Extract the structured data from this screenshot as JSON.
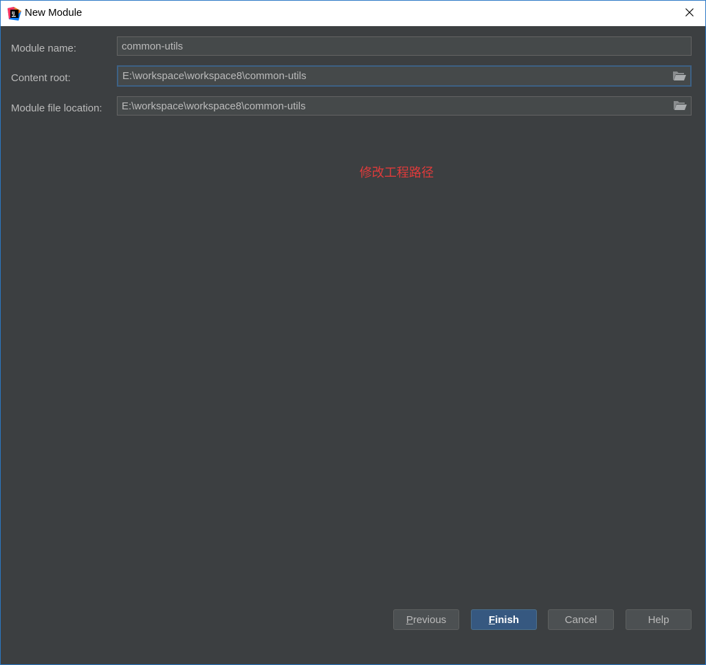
{
  "window": {
    "title": "New Module",
    "app_icon": "intellij-idea-icon",
    "close_icon": "close-icon"
  },
  "form": {
    "module_name": {
      "label": "Module name:",
      "value": "common-utils"
    },
    "content_root": {
      "label": "Content root:",
      "value": "E:\\workspace\\workspace8\\common-utils",
      "browse_icon": "folder-open-icon"
    },
    "module_file_location": {
      "label": "Module file location:",
      "value": "E:\\workspace\\workspace8\\common-utils",
      "browse_icon": "folder-open-icon"
    }
  },
  "annotation": {
    "text": "修改工程路径",
    "color": "#e03b3b"
  },
  "buttons": {
    "previous": {
      "mnemonic": "P",
      "rest": "revious"
    },
    "finish": {
      "mnemonic": "F",
      "rest": "inish"
    },
    "cancel": "Cancel",
    "help": "Help"
  },
  "colors": {
    "background": "#3c3f41",
    "field_background": "#45494a",
    "focus_border": "#3d6185",
    "primary_button": "#365880",
    "text": "#bbbbbb"
  }
}
